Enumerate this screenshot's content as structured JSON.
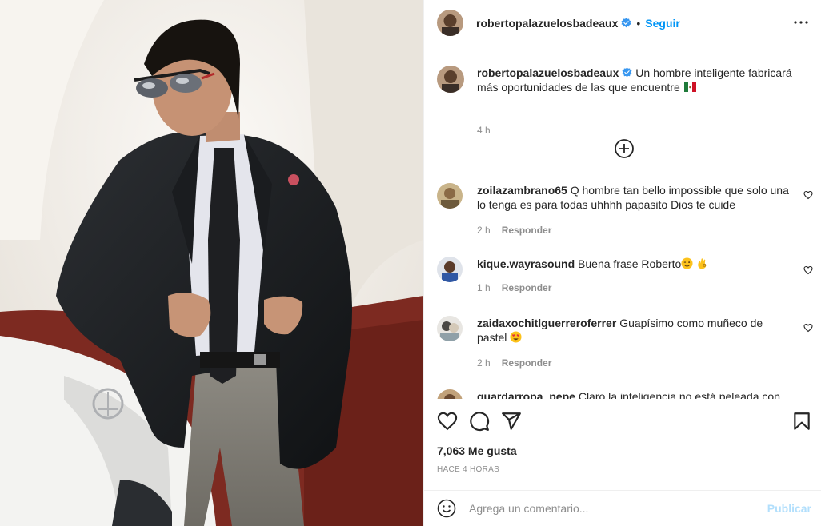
{
  "post": {
    "username": "robertopalazuelosbadeaux",
    "follow_label": "Seguir",
    "separator": "•",
    "caption": "Un hombre inteligente fabricará más oportunidades de las que encuentre",
    "caption_time": "4 h"
  },
  "comments": [
    {
      "username": "zoilazambrano65",
      "text": "Q hombre tan bello impossible que solo una lo tenga es para todas uhhhh papasito Dios te cuide",
      "time": "2 h",
      "reply_label": "Responder"
    },
    {
      "username": "kique.wayrasound",
      "text": "Buena frase Roberto",
      "time": "1 h",
      "reply_label": "Responder"
    },
    {
      "username": "zaidaxochitlguerreroferrer",
      "text": "Guapísimo como muñeco de pastel",
      "time": "2 h",
      "reply_label": "Responder"
    },
    {
      "username": "guardarropa_pepe",
      "text": "Claro la inteligencia no está peleada con"
    }
  ],
  "footer": {
    "likes": "7,063 Me gusta",
    "ago": "HACE 4 HORAS",
    "comment_placeholder": "Agrega un comentario...",
    "publish_label": "Publicar"
  },
  "icons": {
    "more": "more-options-icon",
    "verified": "verified-badge-icon",
    "load_more": "plus-circle-icon",
    "like": "heart-icon",
    "comment": "comment-icon",
    "share": "share-icon",
    "save": "bookmark-icon",
    "emoji": "smiley-icon"
  },
  "colors": {
    "accent": "#0095f6",
    "publish_disabled": "#b2dffc",
    "muted": "#8e8e8e",
    "text": "#262626"
  }
}
